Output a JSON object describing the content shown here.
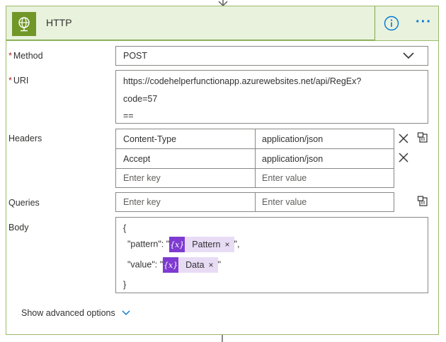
{
  "header": {
    "title": "HTTP",
    "info_icon": "info-icon",
    "more_icon": "more-options-icon",
    "more_label": "···",
    "action_icon": "globe-icon"
  },
  "method": {
    "label": "Method",
    "required_mark": "*",
    "value": "POST"
  },
  "uri": {
    "label": "URI",
    "required_mark": "*",
    "line1": "https://codehelperfunctionapp.azurewebsites.net/api/RegEx?",
    "line2": "code=57",
    "line3": "=="
  },
  "headers": {
    "label": "Headers",
    "rows": [
      {
        "key": "Content-Type",
        "value": "application/json"
      },
      {
        "key": "Accept",
        "value": "application/json"
      }
    ],
    "key_placeholder": "Enter key",
    "value_placeholder": "Enter value"
  },
  "queries": {
    "label": "Queries",
    "key_placeholder": "Enter key",
    "value_placeholder": "Enter value"
  },
  "body": {
    "label": "Body",
    "open_brace": "{",
    "close_brace": "}",
    "pattern_prefix": "\"pattern\": \"",
    "pattern_suffix": "\",",
    "value_prefix": "\"value\": \"",
    "value_suffix": "\"",
    "token_icon_text": "{x}",
    "tokens": [
      {
        "label": "Pattern",
        "remove": "×"
      },
      {
        "label": "Data",
        "remove": "×"
      }
    ]
  },
  "advanced": {
    "label": "Show advanced options"
  },
  "colors": {
    "header_bg": "#e9f2dd",
    "action_icon_bg": "#709727",
    "token_icon_bg": "#7e3ad1",
    "token_bg": "#e8dcf5",
    "accent": "#0078d4",
    "required": "#a4262c"
  }
}
